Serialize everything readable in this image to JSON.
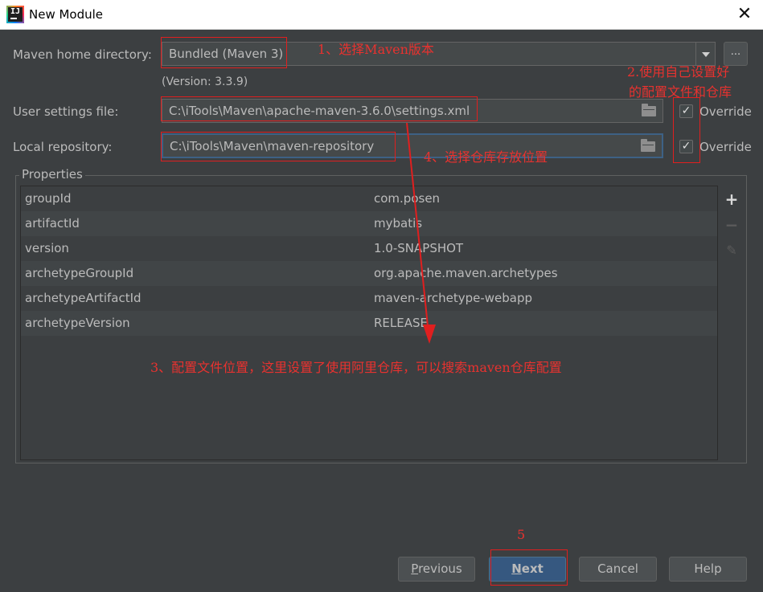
{
  "window": {
    "title": "New Module"
  },
  "form": {
    "maven_home_label": "Maven home directory:",
    "maven_home_value": "Bundled (Maven 3)",
    "more_label": "...",
    "version_text": "(Version: 3.3.9)",
    "user_settings_label": "User settings file:",
    "user_settings_value": "C:\\iTools\\Maven\\apache-maven-3.6.0\\settings.xml",
    "local_repo_label": "Local repository:",
    "local_repo_value": "C:\\iTools\\Maven\\maven-repository",
    "override_label": "Override"
  },
  "properties": {
    "title": "Properties",
    "rows": [
      {
        "key": "groupId",
        "value": "com.posen"
      },
      {
        "key": "artifactId",
        "value": "mybatis"
      },
      {
        "key": "version",
        "value": "1.0-SNAPSHOT"
      },
      {
        "key": "archetypeGroupId",
        "value": "org.apache.maven.archetypes"
      },
      {
        "key": "archetypeArtifactId",
        "value": "maven-archetype-webapp"
      },
      {
        "key": "archetypeVersion",
        "value": "RELEASE"
      }
    ]
  },
  "buttons": {
    "previous_first": "P",
    "previous_rest": "revious",
    "next_first": "N",
    "next_rest": "ext",
    "cancel": "Cancel",
    "help": "Help"
  },
  "annotations": {
    "a1": "1、选择Maven版本",
    "a2_line1": "2.使用自己设置好",
    "a2_line2": "的配置文件和仓库",
    "a3": "3、配置文件位置，这里设置了使用阿里仓库，可以搜索maven仓库配置",
    "a4": "4、选择仓库存放位置",
    "a5": "5"
  },
  "colors": {
    "annotation": "#e01f1f",
    "primary_button": "#365880",
    "background": "#3c3f41"
  }
}
